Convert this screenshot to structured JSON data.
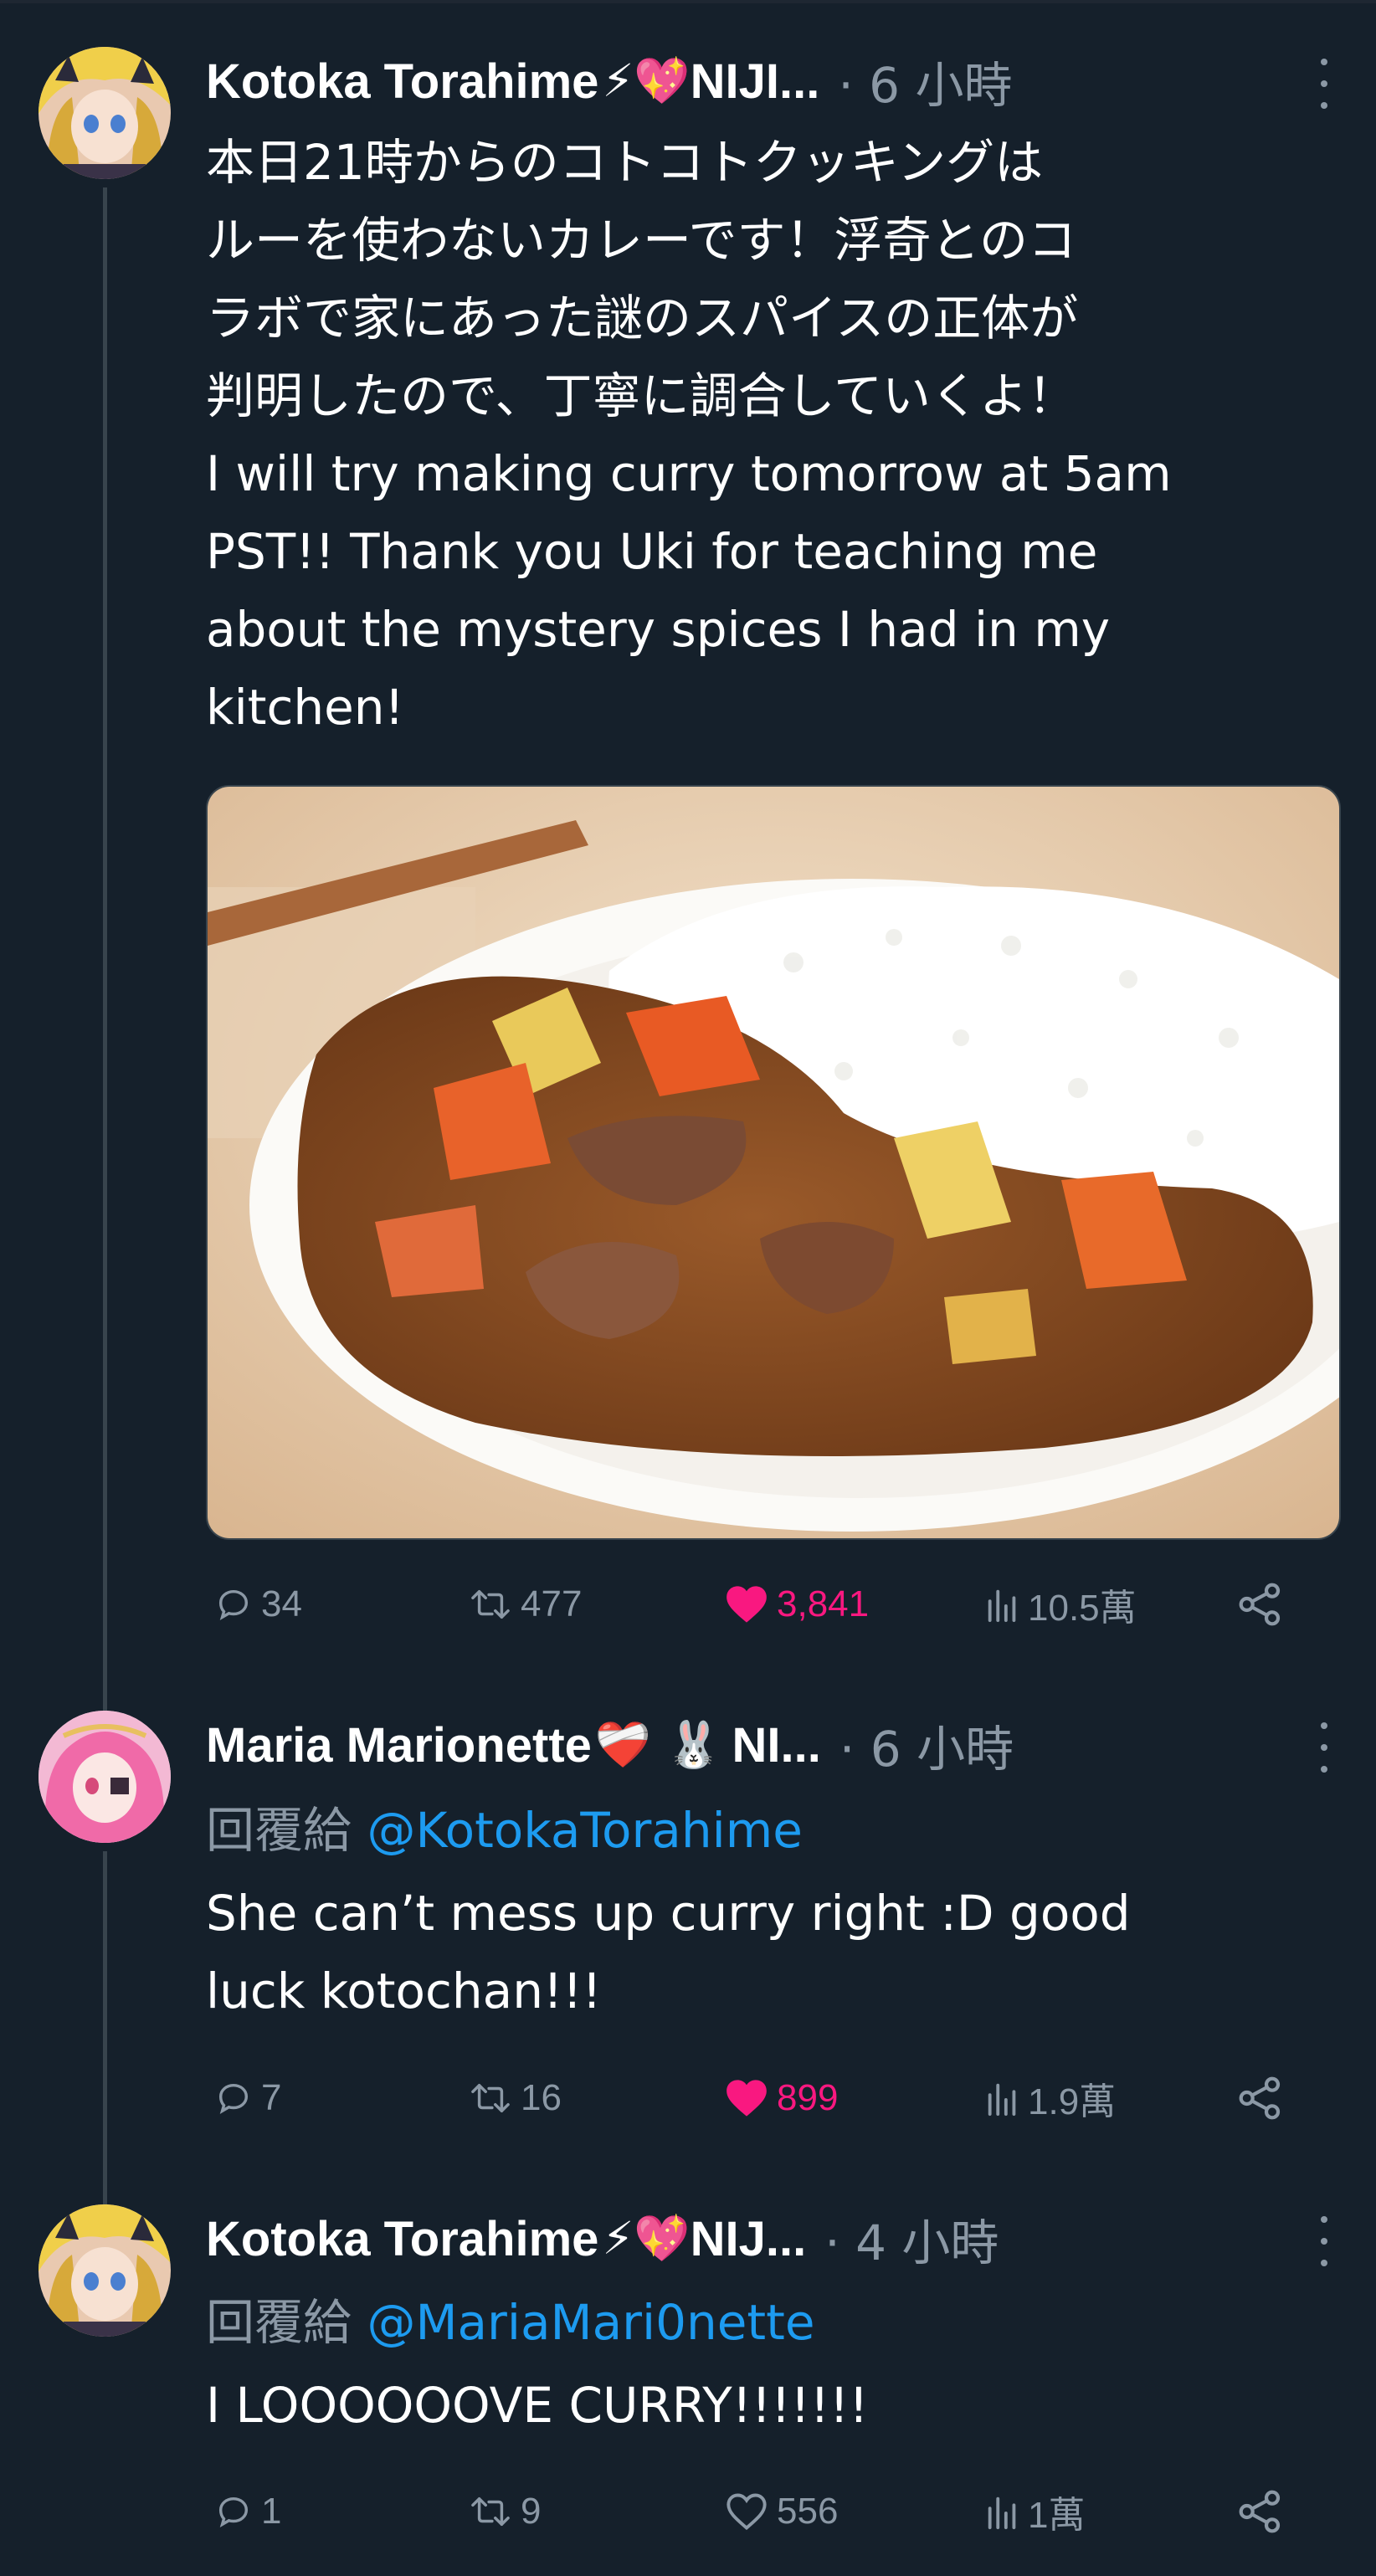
{
  "tweets": [
    {
      "author_name": "Kotoka Torahime",
      "author_emoji": "⚡💖",
      "author_suffix": "NIJI...",
      "time_meta": "· 6 小時",
      "text": "本日21時からのコトコトクッキングは\nルーを使わないカレーです！浮奇とのコ\nラボで家にあった謎のスパイスの正体が\n判明したので、丁寧に調合していくよ！\nI will try making curry tomorrow at 5am\nPST!! Thank you Uki for teaching me\nabout the mystery spices I had in my\nkitchen!",
      "replies": "34",
      "retweets": "477",
      "likes": "3,841",
      "liked": true,
      "views": "10.5萬"
    },
    {
      "author_name": "Maria Marionette",
      "author_emoji": "❤️‍🩹 🐰",
      "author_suffix": "NI...",
      "time_meta": "· 6 小時",
      "reply_prefix": "回覆給 ",
      "reply_handle": "@KotokaTorahime",
      "text": "She can’t mess up curry right :D good\nluck kotochan!!!",
      "replies": "7",
      "retweets": "16",
      "likes": "899",
      "liked": true,
      "views": "1.9萬"
    },
    {
      "author_name": "Kotoka Torahime",
      "author_emoji": "⚡💖",
      "author_suffix": "NIJ...",
      "time_meta": "· 4 小時",
      "reply_prefix": "回覆給 ",
      "reply_handle": "@MariaMari0nette",
      "text": "I LOOOOOOVE CURRY!!!!!!!",
      "replies": "1",
      "retweets": "9",
      "likes": "556",
      "liked": false,
      "views": "1萬"
    }
  ],
  "colors": {
    "background": "#15202b",
    "secondary_text": "#8b98a5",
    "mention": "#1d9bf0",
    "like_active": "#f91880"
  }
}
